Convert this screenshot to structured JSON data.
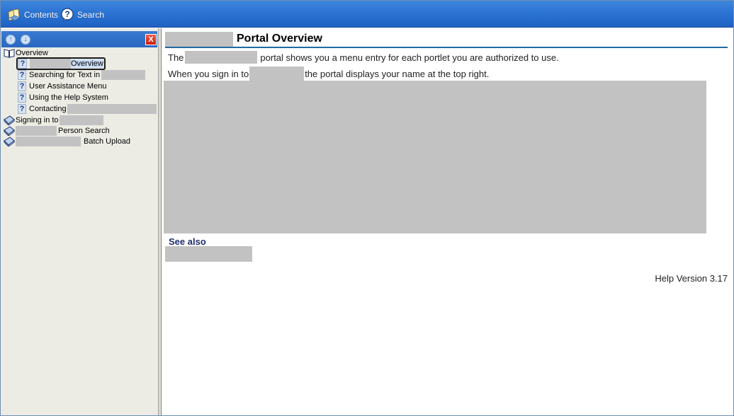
{
  "toolbar": {
    "contents_label": "Contents",
    "search_label": "Search"
  },
  "left_header": {
    "up_glyph": "↑",
    "down_glyph": "↓",
    "close_glyph": "X"
  },
  "toc": {
    "overview": "Overview",
    "item_overview_suffix": "Overview",
    "item_searching": "Searching for Text in",
    "item_user_assistance": "User Assistance Menu",
    "item_using_help": "Using the Help System",
    "item_contacting": "Contacting",
    "signing_in": "Signing in to",
    "person_search": "Person Search",
    "batch_upload": "Batch Upload",
    "question_glyph": "?"
  },
  "content": {
    "title": "Portal Overview",
    "para1_prefix": "The",
    "para1_suffix": "portal shows you a menu entry for each portlet you are authorized to use.",
    "para2_prefix": "When you sign in to",
    "para2_suffix": "the portal displays your name at the top right.",
    "see_also": "See also",
    "help_version": "Help Version 3.17"
  },
  "colors": {
    "toolbar_blue": "#2c74d2",
    "accent_rule": "#1f6aa5",
    "redaction_gray": "#c2c2c2",
    "left_pane_bg": "#ecece4"
  }
}
